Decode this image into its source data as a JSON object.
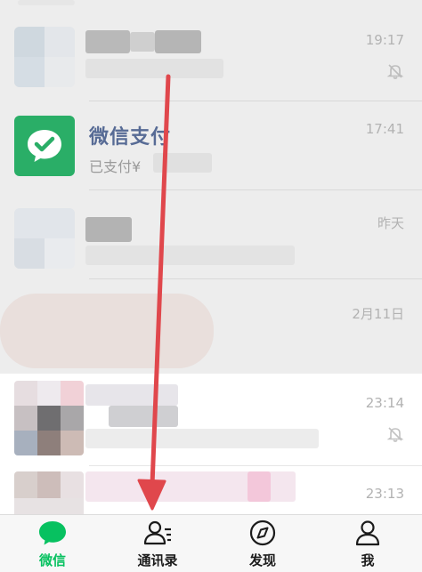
{
  "chats": [
    {
      "time": "19:17",
      "muted": true
    },
    {
      "name": "微信支付",
      "preview": "已支付¥",
      "time": "17:41",
      "muted": false
    },
    {
      "time": "昨天",
      "muted": false
    },
    {
      "time": "2月11日",
      "muted": false
    },
    {
      "time": "23:14",
      "muted": true
    },
    {
      "time": "23:13",
      "muted": false
    }
  ],
  "tabbar": {
    "tabs": [
      {
        "label": "微信",
        "icon": "chat-bubble-icon",
        "active": true
      },
      {
        "label": "通讯录",
        "icon": "contacts-icon",
        "active": false
      },
      {
        "label": "发现",
        "icon": "compass-icon",
        "active": false
      },
      {
        "label": "我",
        "icon": "person-icon",
        "active": false
      }
    ]
  },
  "colors": {
    "accent": "#07c160",
    "pay_green": "#2aae67",
    "arrow": "#e0474c",
    "name_link": "#576b95"
  }
}
